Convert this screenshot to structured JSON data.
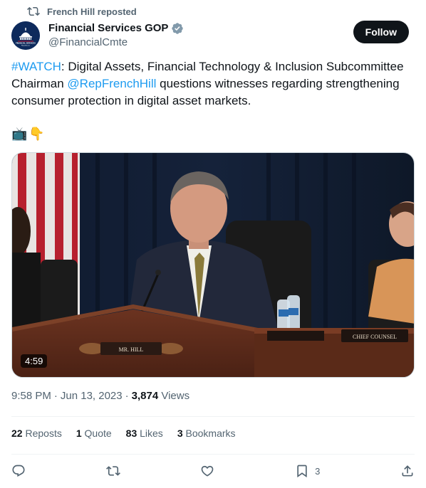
{
  "repost": {
    "label": "French Hill reposted",
    "icon": "repost-icon"
  },
  "author": {
    "display_name": "Financial Services GOP",
    "handle": "@FinancialCmte",
    "verified_icon": "verified-badge-icon",
    "avatar_text": "FINANCIAL SERVICES",
    "avatar_subtext": "Republicans"
  },
  "follow_button": {
    "label": "Follow"
  },
  "tweet": {
    "hashtag": "#WATCH",
    "text_1": ": Digital Assets, Financial Technology & Inclusion Subcommittee Chairman ",
    "mention": "@RepFrenchHill",
    "text_2": " questions witnesses regarding strengthening consumer protection in digital asset markets.",
    "emojis": [
      "📺",
      "👇"
    ]
  },
  "media": {
    "duration": "4:59",
    "nameplate_left": "MR. HILL",
    "nameplate_right": "CHIEF COUNSEL"
  },
  "meta": {
    "time": "9:58 PM",
    "separator": "·",
    "date": "Jun 13, 2023",
    "views_count": "3,874",
    "views_label": "Views"
  },
  "stats": {
    "reposts_count": "22",
    "reposts_label": "Reposts",
    "quotes_count": "1",
    "quotes_label": "Quote",
    "likes_count": "83",
    "likes_label": "Likes",
    "bookmarks_count": "3",
    "bookmarks_label": "Bookmarks"
  },
  "actions": {
    "reply_icon": "reply-icon",
    "repost_icon": "repost-icon",
    "like_icon": "heart-icon",
    "bookmark_icon": "bookmark-icon",
    "bookmark_count": "3",
    "share_icon": "share-icon"
  },
  "colors": {
    "link": "#1d9bf0",
    "text_primary": "#0f1419",
    "text_secondary": "#536471",
    "divider": "#eff3f4",
    "verified": "#829aab"
  }
}
